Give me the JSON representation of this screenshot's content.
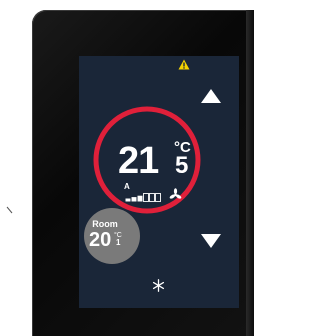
{
  "device": {
    "warning_icon": "warning-triangle-icon",
    "up_button_icon": "triangle-up-icon",
    "down_button_icon": "triangle-down-icon",
    "fan_icon": "fan-icon",
    "mode_icon": "snowflake-icon",
    "accent_color": "#e0203a",
    "warning_color": "#f5d400",
    "screen_color": "#1a2638"
  },
  "setpoint": {
    "integer": "21",
    "decimal": "5",
    "unit": "°C"
  },
  "fan": {
    "mode_label": "A",
    "level": 3,
    "max_level": 6
  },
  "room": {
    "label": "Room",
    "integer": "20",
    "unit": "°C",
    "decimal": "1"
  }
}
